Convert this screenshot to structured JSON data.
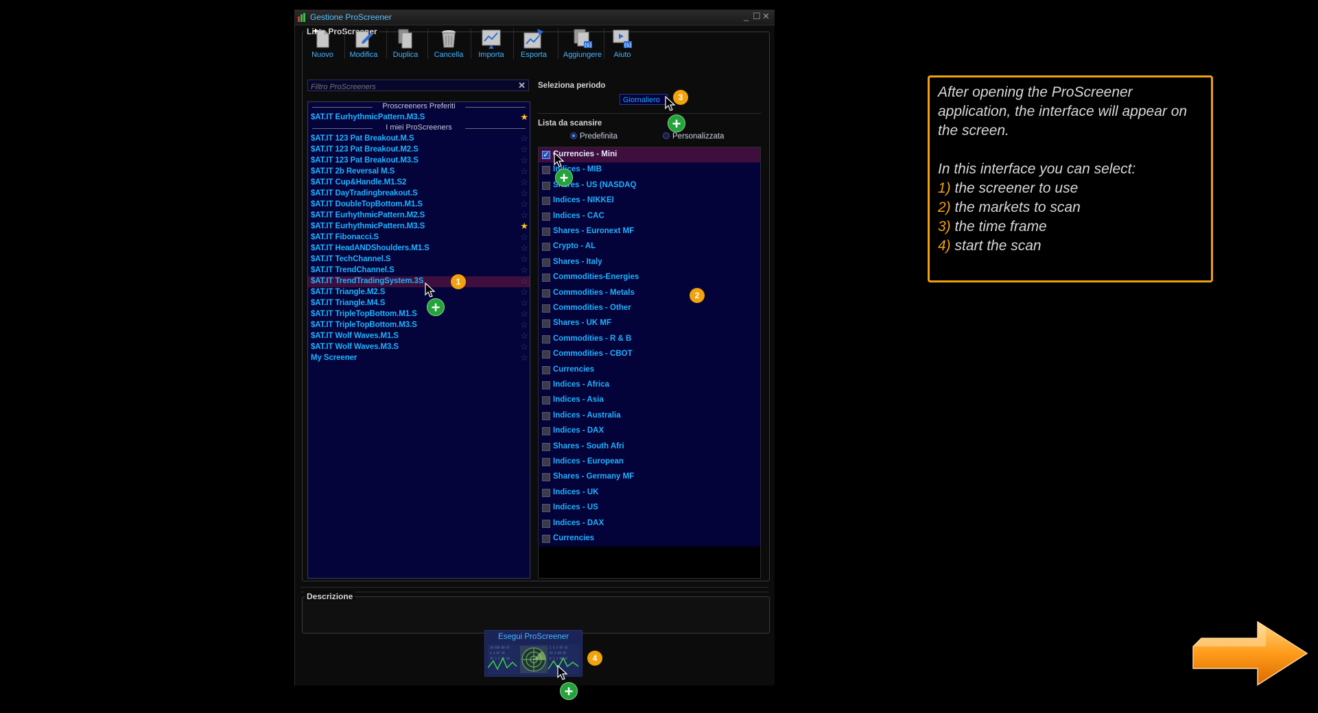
{
  "window": {
    "title": "Gestione ProScreener"
  },
  "panel": {
    "label": "Lista ProScreener"
  },
  "toolbar": [
    {
      "label": "Nuovo",
      "icon": "new-document-icon"
    },
    {
      "label": "Modifica",
      "icon": "edit-icon"
    },
    {
      "label": "Duplica",
      "icon": "duplicate-icon"
    },
    {
      "label": "Cancella",
      "icon": "trash-icon"
    },
    {
      "label": "Importa",
      "icon": "import-icon"
    },
    {
      "label": "Esporta",
      "icon": "export-icon"
    },
    {
      "label": "Aggiungere",
      "icon": "add-icon"
    },
    {
      "label": "Aiuto",
      "icon": "help-icon"
    }
  ],
  "filter": {
    "placeholder": "Filtro ProScreeners"
  },
  "screeners": {
    "favorites_title": "Proscreeners Preferiti",
    "favorites": [
      {
        "name": "$AT.IT EurhythmicPattern.M3.S",
        "starred": true
      }
    ],
    "mine_title": "I miei ProScreeners",
    "mine": [
      {
        "name": "$AT.IT 123 Pat Breakout.M.S",
        "starred": false
      },
      {
        "name": "$AT.IT 123 Pat Breakout.M2.S",
        "starred": false
      },
      {
        "name": "$AT.IT 123 Pat Breakout.M3.S",
        "starred": false
      },
      {
        "name": "$AT.IT 2b Reversal M.S",
        "starred": false
      },
      {
        "name": "$AT.IT Cup&Handle.M1.S2",
        "starred": false
      },
      {
        "name": "$AT.IT DayTradingbreakout.S",
        "starred": false
      },
      {
        "name": "$AT.IT DoubleTopBottom.M1.S",
        "starred": false
      },
      {
        "name": "$AT.IT EurhythmicPattern.M2.S",
        "starred": false
      },
      {
        "name": "$AT.IT EurhythmicPattern.M3.S",
        "starred": true
      },
      {
        "name": "$AT.IT Fibonacci.S",
        "starred": false
      },
      {
        "name": "$AT.IT HeadANDShoulders.M1.S",
        "starred": false
      },
      {
        "name": "$AT.IT TechChannel.S",
        "starred": false
      },
      {
        "name": "$AT.IT TrendChannel.S",
        "starred": false
      },
      {
        "name": "$AT.IT TrendTradingSystem.3S",
        "starred": false,
        "selected": true
      },
      {
        "name": "$AT.IT Triangle.M2.S",
        "starred": false
      },
      {
        "name": "$AT.IT Triangle.M4.S",
        "starred": false
      },
      {
        "name": "$AT.IT TripleTopBottom.M1.S",
        "starred": false
      },
      {
        "name": "$AT.IT TripleTopBottom.M3.S",
        "starred": false
      },
      {
        "name": "$AT.IT Wolf Waves.M1.S",
        "starred": false
      },
      {
        "name": "$AT.IT Wolf Waves.M3.S",
        "starred": false
      },
      {
        "name": "My Screener",
        "starred": false
      }
    ]
  },
  "period": {
    "label": "Seleziona periodo",
    "value": "Giornaliero"
  },
  "scan": {
    "label": "Lista da scansire",
    "options": [
      {
        "label": "Predefinita",
        "checked": true
      },
      {
        "label": "Personalizzata",
        "checked": false
      }
    ],
    "markets": [
      {
        "name": "Currencies - Mini",
        "checked": true
      },
      {
        "name": "Indices - MIB",
        "checked": false
      },
      {
        "name": "Shares - US (NASDAQ",
        "checked": false
      },
      {
        "name": "Indices - NIKKEI",
        "checked": false
      },
      {
        "name": "Indices - CAC",
        "checked": false
      },
      {
        "name": "Shares - Euronext MF",
        "checked": false
      },
      {
        "name": "Crypto - AL",
        "checked": false
      },
      {
        "name": "Shares - Italy",
        "checked": false
      },
      {
        "name": "Commodities-Energies",
        "checked": false
      },
      {
        "name": "Commodities - Metals",
        "checked": false
      },
      {
        "name": "Commodities - Other",
        "checked": false
      },
      {
        "name": "Shares - UK MF",
        "checked": false
      },
      {
        "name": "Commodities - R & B",
        "checked": false
      },
      {
        "name": "Commodities - CBOT",
        "checked": false
      },
      {
        "name": "Currencies",
        "checked": false
      },
      {
        "name": "Indices - Africa",
        "checked": false
      },
      {
        "name": "Indices - Asia",
        "checked": false
      },
      {
        "name": "Indices - Australia",
        "checked": false
      },
      {
        "name": "Indices - DAX",
        "checked": false
      },
      {
        "name": "Shares - South Afri",
        "checked": false
      },
      {
        "name": "Indices - European",
        "checked": false
      },
      {
        "name": "Shares - Germany MF",
        "checked": false
      },
      {
        "name": "Indices - UK",
        "checked": false
      },
      {
        "name": "Indices - US",
        "checked": false
      },
      {
        "name": "Indices - DAX",
        "checked": false
      },
      {
        "name": "Currencies",
        "checked": false
      }
    ]
  },
  "description": {
    "label": "Descrizione"
  },
  "run": {
    "label": "Esegui ProScreener"
  },
  "markers": {
    "m1": "1",
    "m2": "2",
    "m3": "3",
    "m4": "4"
  },
  "info": {
    "intro": "After opening the ProScreener application, the interface will appear on the screen.",
    "lead": "In this interface you can select:",
    "items": [
      {
        "n": "1)",
        "text": " the screener to use"
      },
      {
        "n": "2)",
        "text": " the markets to scan"
      },
      {
        "n": "3)",
        "text": " the time frame"
      },
      {
        "n": "4)",
        "text": " start the scan"
      }
    ]
  },
  "colors": {
    "accent": "#f2a10f",
    "link": "#1fb2ff",
    "list_bg": "#04043a",
    "selection": "#3e0e3c",
    "plus": "#23a33a"
  }
}
